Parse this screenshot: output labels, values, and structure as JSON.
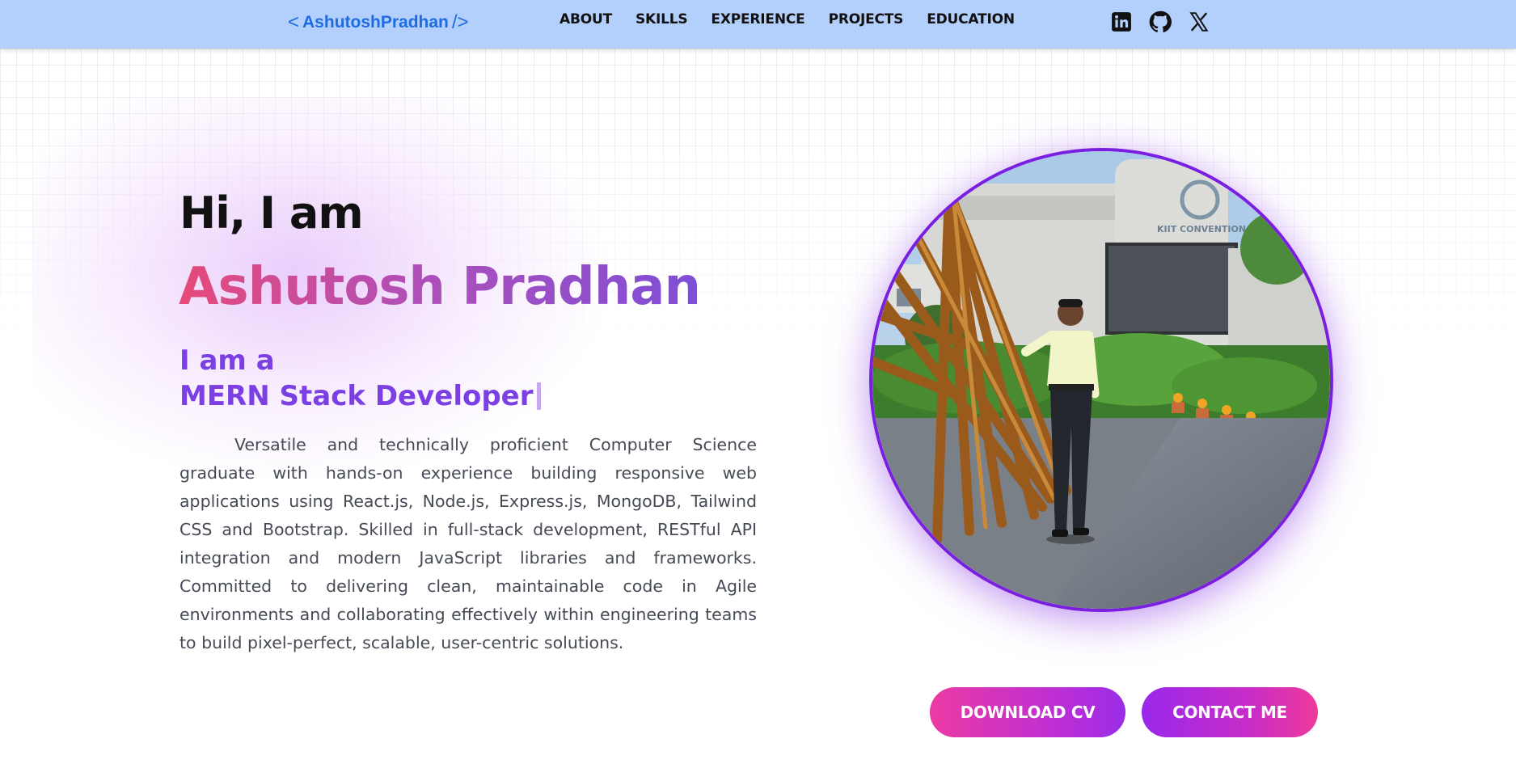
{
  "nav": {
    "logo_open": "<",
    "logo_text": "AshutoshPradhan",
    "logo_close": "/>",
    "links": [
      {
        "label": "ABOUT"
      },
      {
        "label": "SKILLS"
      },
      {
        "label": "EXPERIENCE"
      },
      {
        "label": "PROJECTS"
      },
      {
        "label": "EDUCATION"
      }
    ],
    "socials": [
      "linkedin-icon",
      "github-icon",
      "x-icon"
    ]
  },
  "hero": {
    "greeting": "Hi, I am",
    "name": "Ashutosh Pradhan",
    "role_prefix": "I am a",
    "role": "MERN Stack Developer",
    "bio": "Versatile and technically proficient Computer Science graduate with hands-on experience building responsive web applications using React.js, Node.js, Express.js, MongoDB, Tailwind CSS and Bootstrap. Skilled in full-stack development, RESTful API integration and modern JavaScript libraries and frameworks. Committed to delivering clean, maintainable code in Agile environments and collaborating effectively within engineering teams to build pixel-perfect, scalable, user-centric solutions.",
    "photo_sign": "KIIT CONVENTION CENTRE"
  },
  "buttons": {
    "download_cv": "DOWNLOAD CV",
    "contact_me": "CONTACT ME"
  },
  "colors": {
    "navbar": "#b3cffb",
    "logo": "#1f6be0",
    "role": "#7b3fe4",
    "photo_border": "#7a1fe0"
  }
}
